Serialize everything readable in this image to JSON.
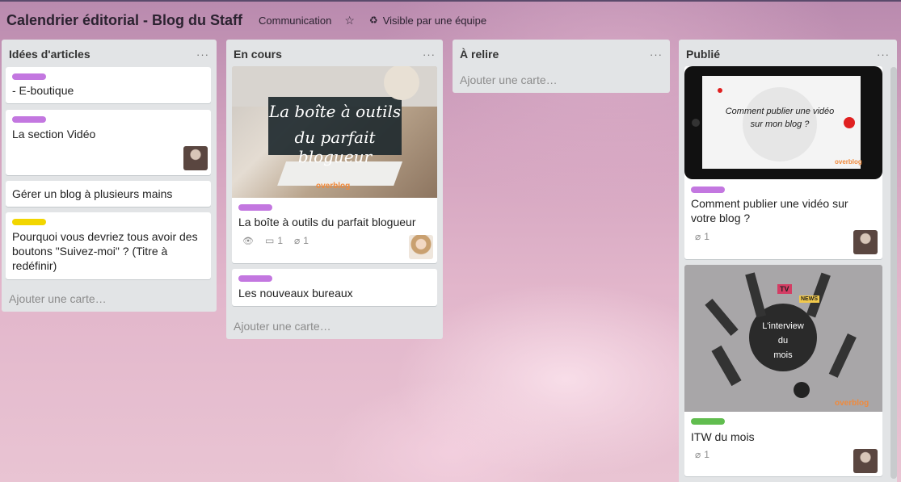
{
  "board": {
    "title": "Calendrier éditorial - Blog du Staff",
    "team": "Communication",
    "star_icon": "☆",
    "visibility": "Visible par une équipe",
    "visibility_icon": "♻"
  },
  "colors": {
    "purple_label": "#c377e0",
    "yellow_label": "#f2d600",
    "green_label": "#61bd4f"
  },
  "lists": [
    {
      "title": "Idées d'articles",
      "menu": "···",
      "cards": [
        {
          "text": "- E-boutique",
          "label": "purple"
        },
        {
          "text": "La section Vidéo",
          "label": "purple"
        },
        {
          "text": "Gérer un blog à plusieurs mains"
        },
        {
          "text": "Pourquoi vous devriez tous avoir des boutons \"Suivez-moi\" ? (Titre à redéfinir)",
          "label": "yellow"
        }
      ],
      "add": "Ajouter une carte…"
    },
    {
      "title": "En cours",
      "menu": "···",
      "cards": [
        {
          "text": "La boîte à outils du parfait blogueur",
          "label": "purple",
          "cover_line1": "La boîte à outils",
          "cover_line2": "du parfait blogueur",
          "cover_brand": "overblog",
          "watch_icon": "👁",
          "comments": "1",
          "attachments": "1"
        },
        {
          "text": "Les nouveaux bureaux",
          "label": "purple"
        }
      ],
      "add": "Ajouter une carte…"
    },
    {
      "title": "À relire",
      "menu": "···",
      "add": "Ajouter une carte…"
    },
    {
      "title": "Publié",
      "menu": "···",
      "cards": [
        {
          "text": "Comment publier une vidéo sur votre blog ?",
          "label": "purple",
          "cover_line1": "Comment publier une vidéo",
          "cover_line2": "sur mon blog ?",
          "cover_brand": "overblog",
          "attachments": "1"
        },
        {
          "text": "ITW du mois",
          "label": "green",
          "cover_line1": "L'interview",
          "cover_line2": "du",
          "cover_line3": "mois",
          "cover_brand": "overblog",
          "tag1": "TV",
          "tag2": "NEWS",
          "attachments": "1"
        }
      ]
    }
  ]
}
